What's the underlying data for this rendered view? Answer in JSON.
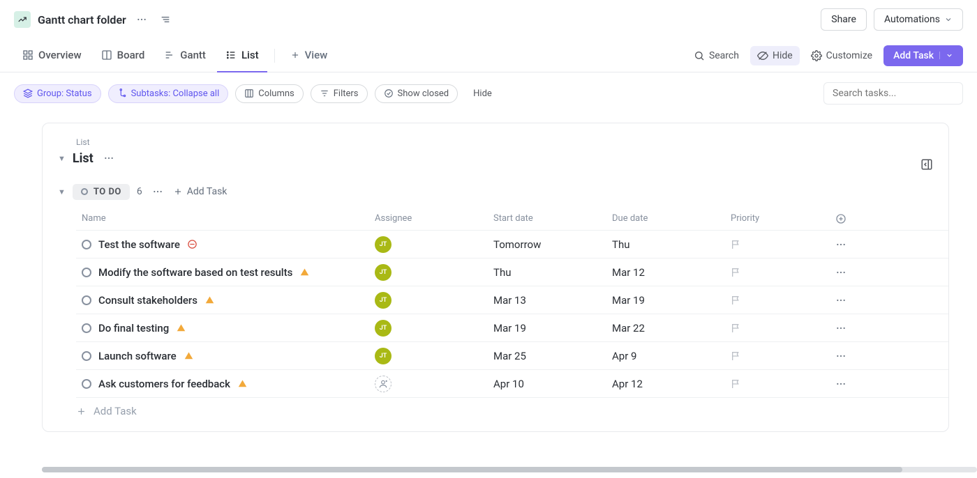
{
  "header": {
    "folder_title": "Gantt chart folder",
    "share_label": "Share",
    "automations_label": "Automations"
  },
  "tabs": {
    "overview": "Overview",
    "board": "Board",
    "gantt": "Gantt",
    "list": "List",
    "add_view": "View"
  },
  "tools": {
    "search": "Search",
    "hide": "Hide",
    "customize": "Customize",
    "add_task": "Add Task"
  },
  "filters": {
    "group": "Group: Status",
    "subtasks": "Subtasks: Collapse all",
    "columns": "Columns",
    "filters_label": "Filters",
    "show_closed": "Show closed",
    "hide_label": "Hide",
    "search_placeholder": "Search tasks..."
  },
  "list": {
    "breadcrumb": "List",
    "title": "List"
  },
  "group": {
    "status_label": "TO DO",
    "count": "6",
    "add_task_label": "Add Task"
  },
  "columns": {
    "name": "Name",
    "assignee": "Assignee",
    "start": "Start date",
    "due": "Due date",
    "priority": "Priority"
  },
  "tasks": [
    {
      "name": "Test the software",
      "assignee": "JT",
      "start": "Tomorrow",
      "due": "Thu",
      "warn": "blocked"
    },
    {
      "name": "Modify the software based on test results",
      "assignee": "JT",
      "start": "Thu",
      "due": "Mar 12",
      "warn": "wait"
    },
    {
      "name": "Consult stakeholders",
      "assignee": "JT",
      "start": "Mar 13",
      "due": "Mar 19",
      "warn": "wait"
    },
    {
      "name": "Do final testing",
      "assignee": "JT",
      "start": "Mar 19",
      "due": "Mar 22",
      "warn": "wait"
    },
    {
      "name": "Launch software",
      "assignee": "JT",
      "start": "Mar 25",
      "due": "Apr 9",
      "warn": "wait"
    },
    {
      "name": "Ask customers for feedback",
      "assignee": "",
      "start": "Apr 10",
      "due": "Apr 12",
      "warn": "wait"
    }
  ],
  "footer": {
    "add_task": "Add Task"
  }
}
